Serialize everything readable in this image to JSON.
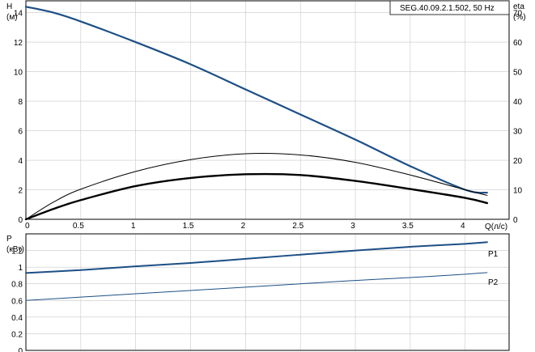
{
  "chart_data": [
    {
      "type": "line",
      "legend_text": "SEG.40.09.2.1.502, 50 Hz",
      "xlabel": "Q(л/с)",
      "ylabel_left": [
        "H",
        "(м)"
      ],
      "ylabel_right": [
        "eta",
        "(%)"
      ],
      "xlim": [
        0,
        4.4
      ],
      "ylim_left": [
        0,
        14.8
      ],
      "ylim_right": [
        0,
        74
      ],
      "x_ticks": [
        "0",
        "0.5",
        "1",
        "1.5",
        "2",
        "2.5",
        "3",
        "3.5",
        "4"
      ],
      "y_ticks_left": [
        "0",
        "2",
        "4",
        "6",
        "8",
        "10",
        "12",
        "14"
      ],
      "y_ticks_right": [
        "0",
        "10",
        "20",
        "30",
        "40",
        "50",
        "60",
        "70"
      ],
      "grid": true,
      "series": [
        {
          "id": "head",
          "axis": "left",
          "color": "#1c4f85",
          "points": [
            [
              0,
              14.4
            ],
            [
              0.25,
              14.0
            ],
            [
              0.5,
              13.4
            ],
            [
              1.0,
              12.0
            ],
            [
              1.5,
              10.5
            ],
            [
              2.0,
              8.8
            ],
            [
              2.5,
              7.1
            ],
            [
              3.0,
              5.4
            ],
            [
              3.5,
              3.6
            ],
            [
              4.0,
              2.0
            ],
            [
              4.2,
              1.8
            ]
          ]
        },
        {
          "id": "efficiency",
          "axis": "right",
          "color": "#000000",
          "points": [
            [
              0,
              0
            ],
            [
              0.25,
              5.8
            ],
            [
              0.5,
              10.2
            ],
            [
              1.0,
              16.2
            ],
            [
              1.5,
              20.2
            ],
            [
              2.0,
              22.2
            ],
            [
              2.5,
              21.8
            ],
            [
              3.0,
              19.3
            ],
            [
              3.5,
              15.0
            ],
            [
              4.0,
              10.0
            ],
            [
              4.2,
              8.1
            ]
          ]
        },
        {
          "id": "efficiency-2",
          "axis": "left",
          "color": "#000000",
          "points": [
            [
              0,
              0
            ],
            [
              0.25,
              0.7
            ],
            [
              0.5,
              1.3
            ],
            [
              1.0,
              2.25
            ],
            [
              1.5,
              2.8
            ],
            [
              2.0,
              3.05
            ],
            [
              2.5,
              3.0
            ],
            [
              3.0,
              2.6
            ],
            [
              3.5,
              2.05
            ],
            [
              4.0,
              1.45
            ],
            [
              4.2,
              1.1
            ]
          ]
        }
      ]
    },
    {
      "type": "line",
      "xlim": [
        0,
        4.4
      ],
      "ylabel_left": [
        "P",
        "(кВт)"
      ],
      "ylim": [
        0,
        1.4
      ],
      "y_ticks_left": [
        "0",
        "0.2",
        "0.4",
        "0.6",
        "0.8",
        "1",
        "1.2"
      ],
      "grid": true,
      "series": [
        {
          "id": "p1",
          "name": "P1",
          "color": "#1c4f85",
          "points": [
            [
              0,
              0.93
            ],
            [
              0.5,
              0.965
            ],
            [
              1.0,
              1.01
            ],
            [
              1.5,
              1.05
            ],
            [
              2.0,
              1.1
            ],
            [
              2.5,
              1.15
            ],
            [
              3.0,
              1.2
            ],
            [
              3.5,
              1.245
            ],
            [
              4.0,
              1.28
            ],
            [
              4.2,
              1.3
            ]
          ]
        },
        {
          "id": "p2",
          "name": "P2",
          "color": "#1c4f85",
          "points": [
            [
              0,
              0.6
            ],
            [
              0.5,
              0.64
            ],
            [
              1.0,
              0.68
            ],
            [
              1.5,
              0.72
            ],
            [
              2.0,
              0.76
            ],
            [
              2.5,
              0.8
            ],
            [
              3.0,
              0.84
            ],
            [
              3.5,
              0.875
            ],
            [
              4.0,
              0.915
            ],
            [
              4.2,
              0.935
            ]
          ]
        }
      ]
    }
  ]
}
